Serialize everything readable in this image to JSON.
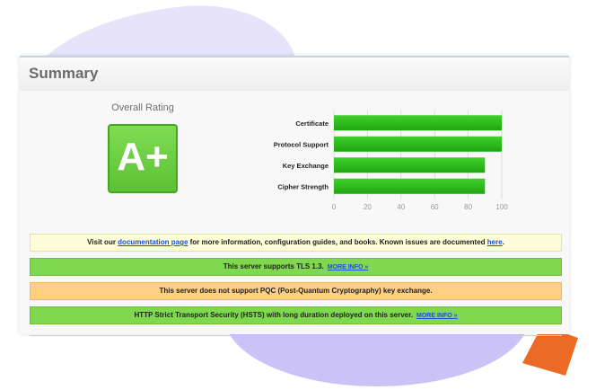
{
  "summary": {
    "title": "Summary",
    "overall_rating_label": "Overall Rating",
    "grade": "A+",
    "grade_color": "#6ad03f"
  },
  "chart_data": {
    "type": "bar",
    "orientation": "horizontal",
    "categories": [
      "Certificate",
      "Protocol Support",
      "Key Exchange",
      "Cipher Strength"
    ],
    "values": [
      100,
      100,
      90,
      90
    ],
    "xlim": [
      0,
      100
    ],
    "ticks": [
      0,
      20,
      40,
      60,
      80,
      100
    ],
    "grid": true,
    "bar_color": "#2fc21a"
  },
  "notices": {
    "docs": {
      "before": "Visit our ",
      "link1": "documentation page",
      "middle": " for more information, configuration guides, and books. Known issues are documented ",
      "link2": "here",
      "after": "."
    },
    "tls": {
      "text": "This server supports TLS 1.3.",
      "link": "MORE INFO »"
    },
    "pqc": {
      "text": "This server does not support PQC (Post-Quantum Cryptography) key exchange."
    },
    "hsts": {
      "text": "HTTP Strict Transport Security (HSTS) with long duration deployed on this server.",
      "link": "MORE INFO »"
    }
  },
  "colors": {
    "accent_orange": "#ea6a26",
    "blob_light": "#e7e3fb",
    "blob_purple": "#cbc2f6"
  }
}
